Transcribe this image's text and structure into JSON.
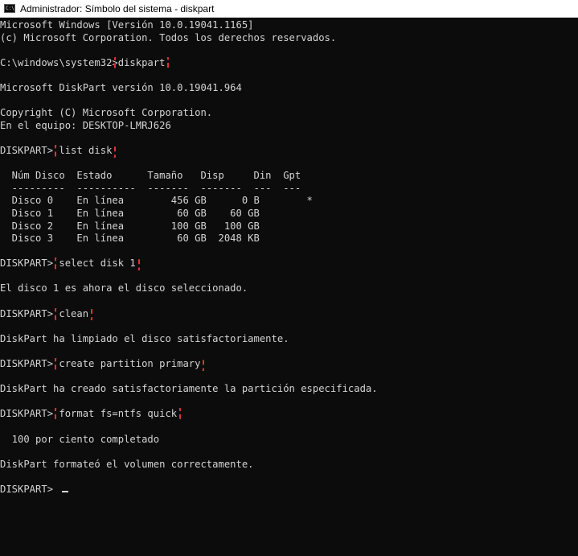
{
  "window": {
    "icon_label": "C:\\",
    "title": "Administrador: Símbolo del sistema - diskpart"
  },
  "console": {
    "header_line1": "Microsoft Windows [Versión 10.0.19041.1165]",
    "header_line2": "(c) Microsoft Corporation. Todos los derechos reservados.",
    "cmd_prompt": "C:\\windows\\system32>",
    "cmd_diskpart": "diskpart",
    "dp_version": "Microsoft DiskPart versión 10.0.19041.964",
    "copyright": "Copyright (C) Microsoft Corporation.",
    "machine": "En el equipo: DESKTOP-LMRJ626",
    "prompt": "DISKPART> ",
    "cmd_list_disk": "list disk",
    "table_header": "  Núm Disco  Estado      Tamaño   Disp     Din  Gpt",
    "table_sep": "  ---------  ----------  -------  -------  ---  ---",
    "rows": [
      "  Disco 0    En línea        456 GB      0 B        *",
      "  Disco 1    En línea         60 GB    60 GB",
      "  Disco 2    En línea        100 GB   100 GB",
      "  Disco 3    En línea         60 GB  2048 KB"
    ],
    "cmd_select_disk": "select disk 1",
    "msg_selected": "El disco 1 es ahora el disco seleccionado.",
    "cmd_clean": "clean",
    "msg_clean": "DiskPart ha limpiado el disco satisfactoriamente.",
    "cmd_create_partition": "create partition primary",
    "msg_create": "DiskPart ha creado satisfactoriamente la partición especificada.",
    "cmd_format": "format fs=ntfs quick",
    "msg_progress": "  100 por ciento completado",
    "msg_format": "DiskPart formateó el volumen correctamente.",
    "final_prompt": "DISKPART> "
  }
}
